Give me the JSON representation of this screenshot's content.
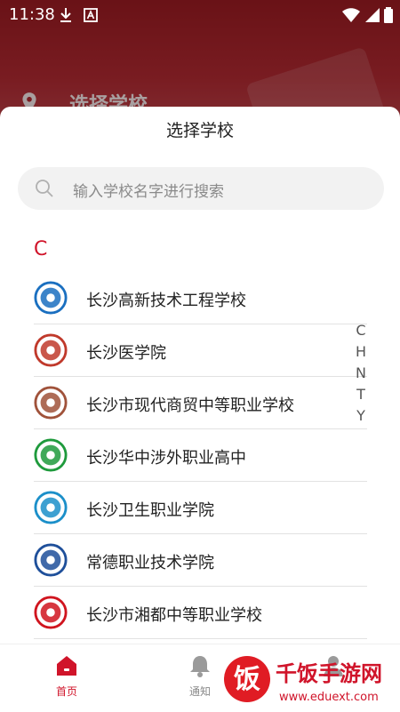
{
  "status_bar": {
    "time": "11:38"
  },
  "background": {
    "title": "选择学校"
  },
  "sheet": {
    "title": "选择学校",
    "search_placeholder": "输入学校名字进行搜索",
    "section": "C",
    "schools": [
      {
        "name": "长沙高新技术工程学校",
        "logo_color": "#1a6fc0"
      },
      {
        "name": "长沙医学院",
        "logo_color": "#c0392b"
      },
      {
        "name": "长沙市现代商贸中等职业学校",
        "logo_color": "#a0523a"
      },
      {
        "name": "长沙华中涉外职业高中",
        "logo_color": "#1e9a3c"
      },
      {
        "name": "长沙卫生职业学院",
        "logo_color": "#1b8fc9"
      },
      {
        "name": "常德职业技术学院",
        "logo_color": "#1e4f9a"
      },
      {
        "name": "长沙市湘都中等职业学校",
        "logo_color": "#d0141e"
      }
    ],
    "index_letters": [
      "C",
      "H",
      "N",
      "T",
      "Y"
    ]
  },
  "bottom_nav": {
    "items": [
      {
        "label": "首页",
        "icon": "home-icon",
        "active": true
      },
      {
        "label": "通知",
        "icon": "bell-icon",
        "active": false
      }
    ],
    "active_color": "#d0142a"
  },
  "watermark": {
    "text": "千饭手游网",
    "url": "www.eduext.com"
  }
}
